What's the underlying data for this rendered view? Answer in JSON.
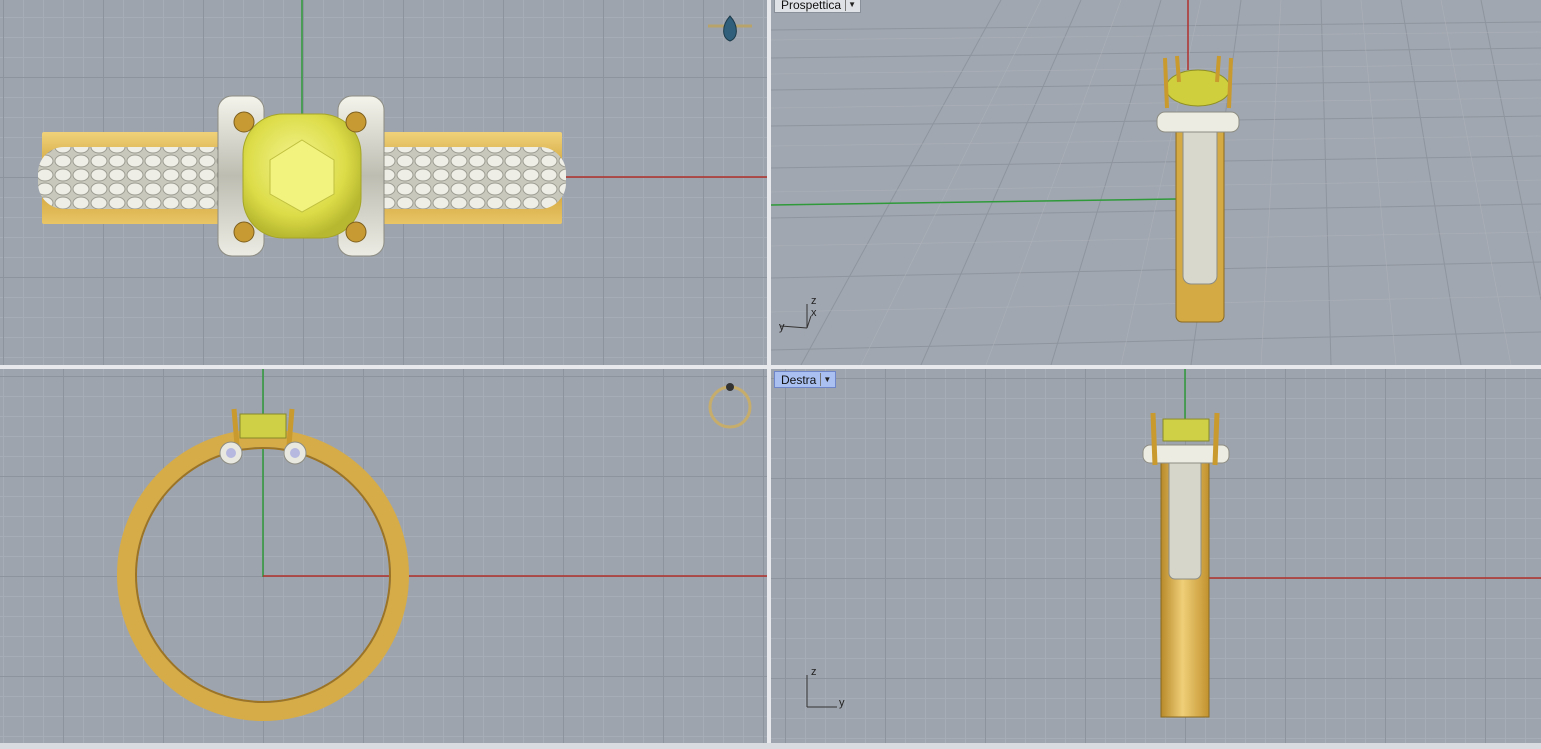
{
  "viewports": {
    "top": {
      "name": ""
    },
    "perspective": {
      "name": "Prospettica"
    },
    "front": {
      "name": ""
    },
    "right": {
      "name": "Destra"
    }
  },
  "axes": {
    "perspective": {
      "z": "z",
      "x": "x",
      "y": "y"
    },
    "right": {
      "z": "z",
      "y": "y"
    }
  },
  "colors": {
    "viewport_bg": "#9ea4ad",
    "grid_major": "#8e949d",
    "x_axis": "#b0302c",
    "y_axis": "#2f9a3a",
    "gold": "#d8b04a",
    "silver": "#dcdcd2",
    "gem": "#e2e25a",
    "active_tab": "#a9c0f0"
  }
}
